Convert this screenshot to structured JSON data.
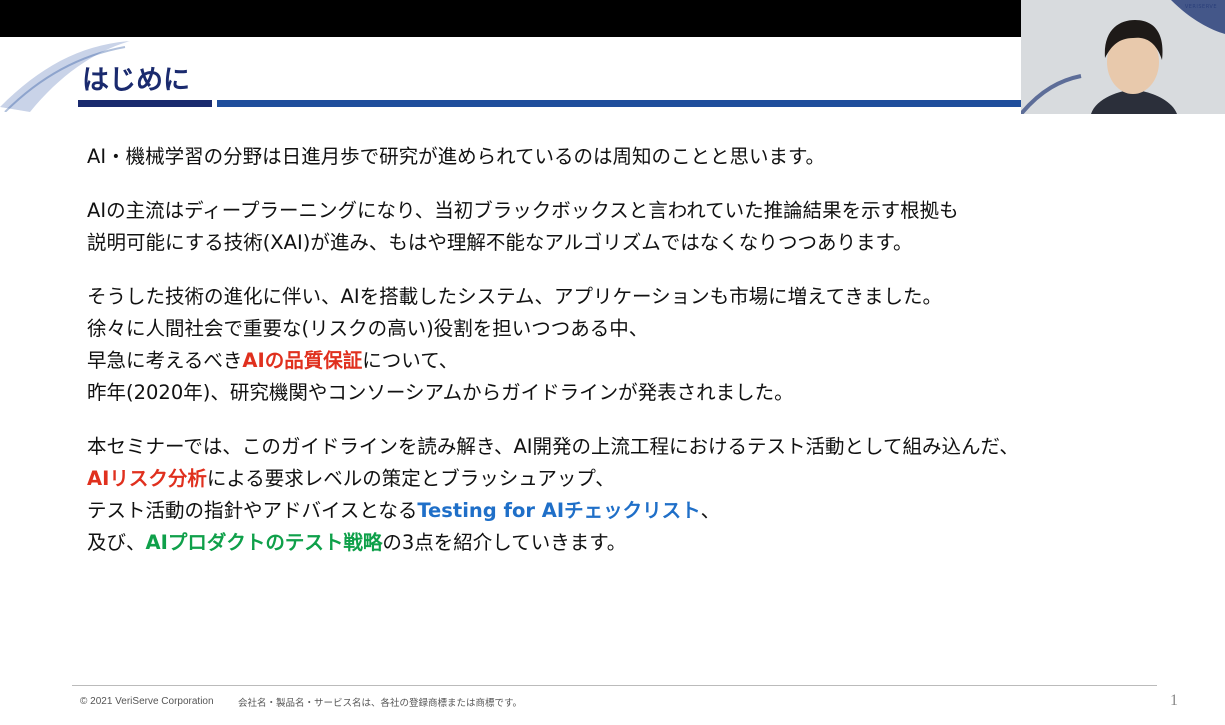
{
  "slide": {
    "title": "はじめに"
  },
  "body": {
    "p1": {
      "line1": "AI・機械学習の分野は日進月歩で研究が進められているのは周知のことと思います。"
    },
    "p2": {
      "line1": "AIの主流はディープラーニングになり、当初ブラックボックスと言われていた推論結果を示す根拠も",
      "line2": "説明可能にする技術(XAI)が進み、もはや理解不能なアルゴリズムではなくなりつつあります。"
    },
    "p3": {
      "line1": "そうした技術の進化に伴い、AIを搭載したシステム、アプリケーションも市場に増えてきました。",
      "line2": "徐々に人間社会で重要な(リスクの高い)役割を担いつつある中、",
      "line3_pre": "早急に考えるべき",
      "line3_em": "AIの品質保証",
      "line3_post": "について、",
      "line4": "昨年(2020年)、研究機関やコンソーシアムからガイドラインが発表されました。"
    },
    "p4": {
      "line1": "本セミナーでは、このガイドラインを読み解き、AI開発の上流工程におけるテスト活動として組み込んだ、",
      "line2_em": "AIリスク分析",
      "line2_post": "による要求レベルの策定とブラッシュアップ、",
      "line3_pre": "テスト活動の指針やアドバイスとなる",
      "line3_em": "Testing for AIチェックリスト",
      "line3_post": "、",
      "line4_pre": "及び、",
      "line4_em": "AIプロダクトのテスト戦略",
      "line4_post": "の3点を紹介していきます。"
    }
  },
  "footer": {
    "copyright": "© 2021 VeriServe Corporation",
    "trademark": "会社名・製品名・サービス名は、各社の登録商標または商標です。",
    "page_number": "1"
  },
  "webcam": {
    "brand": "VERISERVE"
  },
  "colors": {
    "title": "#1a2a6e",
    "rule": "#1f4e9c",
    "emphasis_red": "#e0301e",
    "emphasis_blue": "#1f6fc8",
    "emphasis_green": "#0fa04a"
  }
}
